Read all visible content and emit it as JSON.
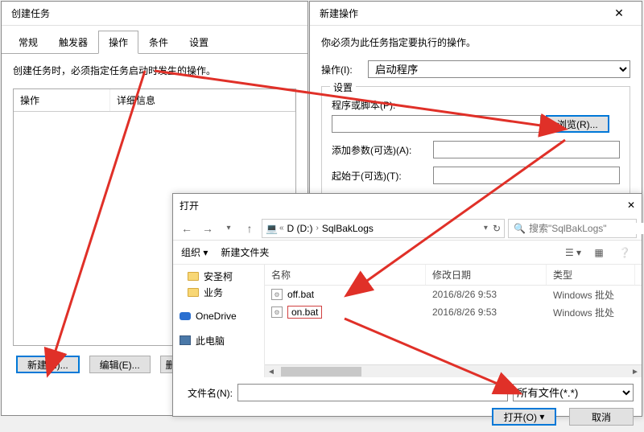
{
  "create_task": {
    "title": "创建任务",
    "tabs": [
      "常规",
      "触发器",
      "操作",
      "条件",
      "设置"
    ],
    "active_tab": 2,
    "hint": "创建任务时，必须指定任务启动时发生的操作。",
    "columns": [
      "操作",
      "详细信息"
    ],
    "buttons": {
      "new": "新建(N)...",
      "edit": "编辑(E)...",
      "del": "删"
    }
  },
  "new_action": {
    "title": "新建操作",
    "hint": "你必须为此任务指定要执行的操作。",
    "action_label": "操作(I):",
    "action_value": "启动程序",
    "group_legend": "设置",
    "program_label": "程序或脚本(P):",
    "browse_btn": "浏览(R)...",
    "args_label": "添加参数(可选)(A):",
    "startin_label": "起始于(可选)(T):"
  },
  "open_dialog": {
    "title": "打开",
    "breadcrumb": [
      "D (D:)",
      "SqlBakLogs"
    ],
    "search_placeholder": "搜索\"SqlBakLogs\"",
    "toolbar": {
      "organize": "组织 ▾",
      "new_folder": "新建文件夹"
    },
    "sidebar": [
      {
        "type": "folder",
        "label": "安圣柯"
      },
      {
        "type": "folder",
        "label": "业务"
      },
      {
        "type": "spacer"
      },
      {
        "type": "onedrive",
        "label": "OneDrive"
      },
      {
        "type": "spacer"
      },
      {
        "type": "pc",
        "label": "此电脑"
      }
    ],
    "file_columns": {
      "name": "名称",
      "date": "修改日期",
      "type": "类型"
    },
    "files": [
      {
        "name": "off.bat",
        "date": "2016/8/26 9:53",
        "type": "Windows 批处",
        "selected": false
      },
      {
        "name": "on.bat",
        "date": "2016/8/26 9:53",
        "type": "Windows 批处",
        "selected": true
      }
    ],
    "filename_label": "文件名(N):",
    "filter": "所有文件(*.*)",
    "open_btn": "打开(O)",
    "cancel_btn": "取消"
  }
}
